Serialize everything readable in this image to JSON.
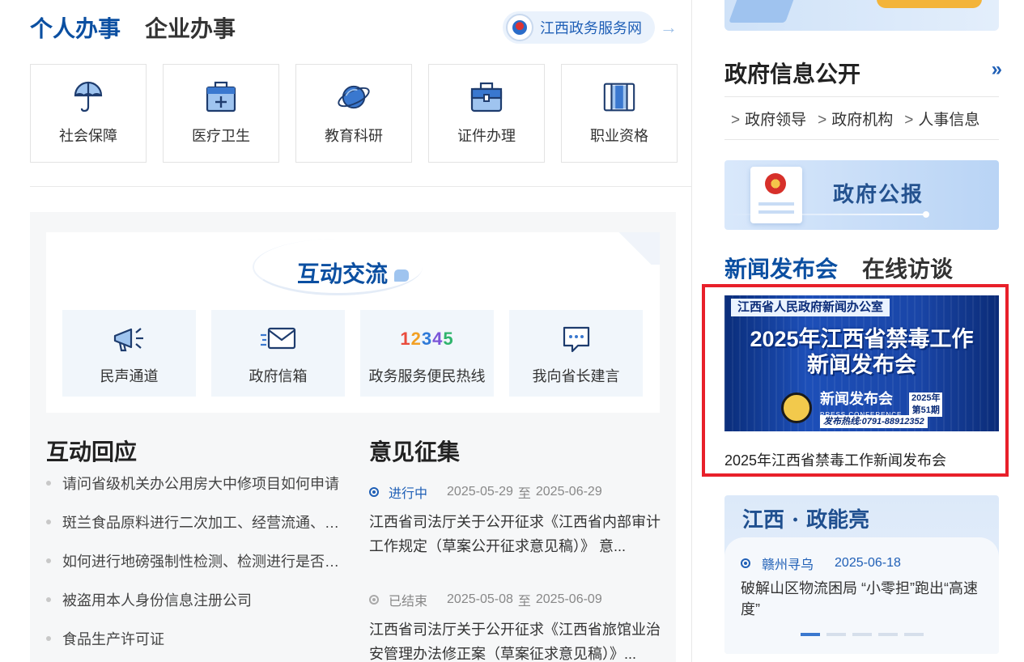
{
  "personal": {
    "tabs": [
      "个人办事",
      "企业办事"
    ],
    "portal_label": "江西政务服务网",
    "portal_arrow": "→",
    "services": [
      {
        "label": "社会保障",
        "icon": "umbrella-icon"
      },
      {
        "label": "医疗卫生",
        "icon": "medical-kit-icon"
      },
      {
        "label": "教育科研",
        "icon": "planet-icon"
      },
      {
        "label": "证件办理",
        "icon": "briefcase-icon"
      },
      {
        "label": "职业资格",
        "icon": "book-icon"
      }
    ]
  },
  "interaction": {
    "title": "互动交流",
    "channels": [
      {
        "label": "民声通道",
        "icon": "megaphone-icon"
      },
      {
        "label": "政府信箱",
        "icon": "mail-icon"
      },
      {
        "label": "政务服务便民热线",
        "icon": "hotline-12345-icon",
        "digits": [
          "1",
          "2",
          "3",
          "4",
          "5"
        ]
      },
      {
        "label": "我向省长建言",
        "icon": "chat-bubble-icon"
      }
    ]
  },
  "responses": {
    "title": "互动回应",
    "items": [
      "请问省级机关办公用房大中修项目如何申请",
      "斑兰食品原料进行二次加工、经营流通、销售",
      "如何进行地磅强制性检测、检测进行是否收费",
      "被盗用本人身份信息注册公司",
      "食品生产许可证"
    ]
  },
  "opinions": {
    "title": "意见征集",
    "date_sep": "至",
    "items": [
      {
        "status": "进行中",
        "start": "2025-05-29",
        "end": "2025-06-29",
        "text": "江西省司法厅关于公开征求《江西省内部审计工作规定（草案公开征求意见稿）》 意...",
        "ended": false
      },
      {
        "status": "已结束",
        "start": "2025-05-08",
        "end": "2025-06-09",
        "text": "江西省司法厅关于公开征求《江西省旅馆业治安管理办法修正案（草案征求意见稿）》...",
        "ended": true
      }
    ]
  },
  "gov_info": {
    "title": "政府信息公开",
    "more": "»",
    "links": [
      "政府领导",
      "政府机构",
      "人事信息"
    ],
    "chevron": ">"
  },
  "bulletin": {
    "label": "政府公报"
  },
  "news": {
    "tabs": [
      "新闻发布会",
      "在线访谈"
    ],
    "banner": {
      "office": "江西省人民政府新闻办公室",
      "title_line1": "2025年江西省禁毒工作",
      "title_line2": "新闻发布会",
      "conf_label": "新闻发布会",
      "conf_en": "PRESS CONFERENCE",
      "year": "2025年",
      "issue": "第51期",
      "hotline": "发布热线:0791-88912352"
    },
    "caption": "2025年江西省禁毒工作新闻发布会"
  },
  "jx": {
    "title": "江西 · 政能亮",
    "location": "赣州寻乌",
    "date": "2025-06-18",
    "text": "破解山区物流困局 “小零担”跑出“高速度”",
    "slides": 5,
    "active_slide": 0
  },
  "colors": {
    "brand_blue": "#0b4fa1",
    "accent_blue": "#1f5fb6",
    "highlight_red": "#e8202a",
    "digit_colors": [
      "#e94b3c",
      "#f2a024",
      "#2f7ad8",
      "#7b55d8",
      "#2fb46c"
    ]
  }
}
